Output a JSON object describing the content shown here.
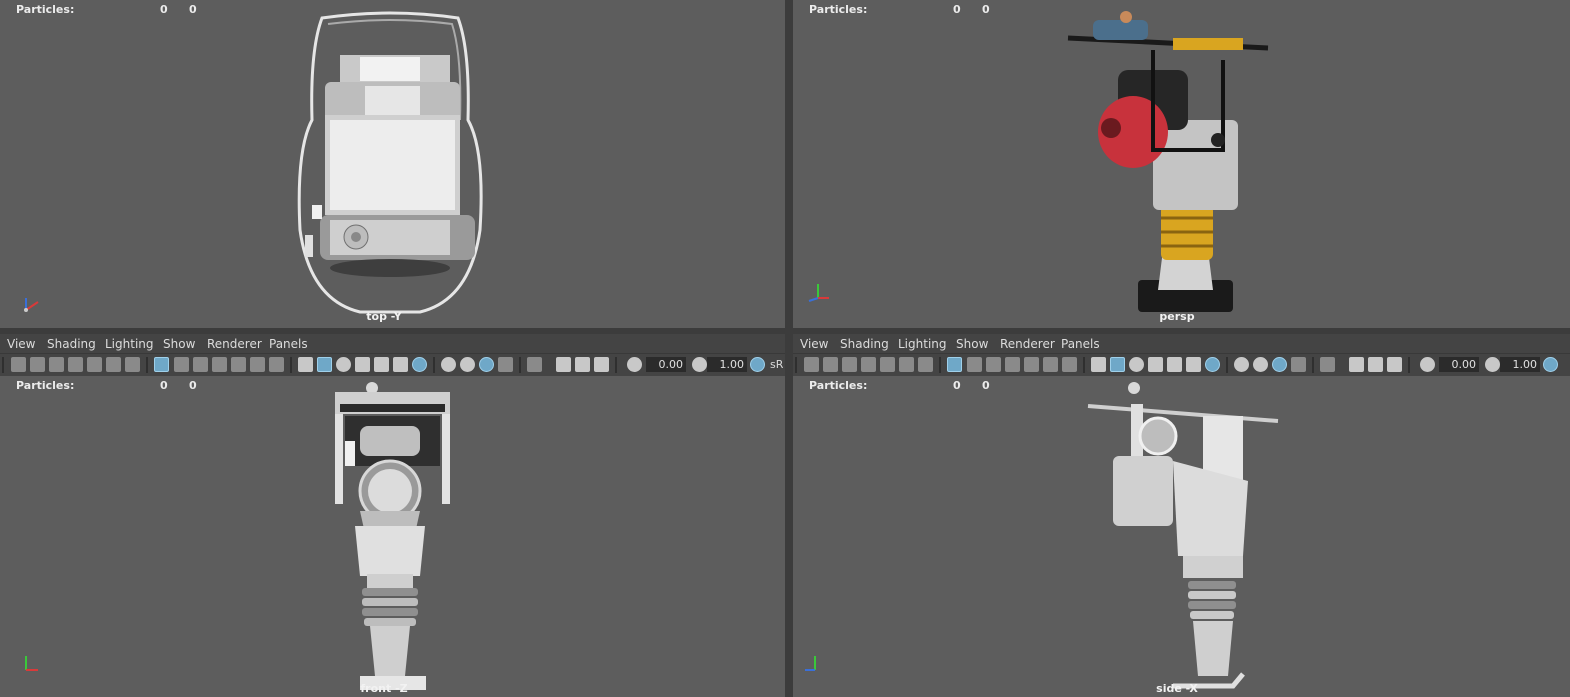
{
  "viewports": {
    "top": {
      "particles_label": "Particles:",
      "v1": "0",
      "v2": "0",
      "camera": "top -Y"
    },
    "persp": {
      "particles_label": "Particles:",
      "v1": "0",
      "v2": "0",
      "camera": "persp"
    },
    "front": {
      "particles_label": "Particles:",
      "v1": "0",
      "v2": "0",
      "camera": "front -Z"
    },
    "side": {
      "particles_label": "Particles:",
      "v1": "0",
      "v2": "0",
      "camera": "side -X"
    }
  },
  "menu": {
    "view": "View",
    "shading": "Shading",
    "lighting": "Lighting",
    "show": "Show",
    "renderer": "Renderer",
    "panels": "Panels"
  },
  "toolbar": {
    "exposure": "0.00",
    "gamma": "1.00",
    "colorspace_label": "sR"
  },
  "colors": {
    "viewport_bg": "#5d5d5d",
    "ui_bg": "#444444",
    "accent_blue": "#6fa8c8",
    "model_red": "#c8323c",
    "model_yellow": "#d9a520"
  }
}
